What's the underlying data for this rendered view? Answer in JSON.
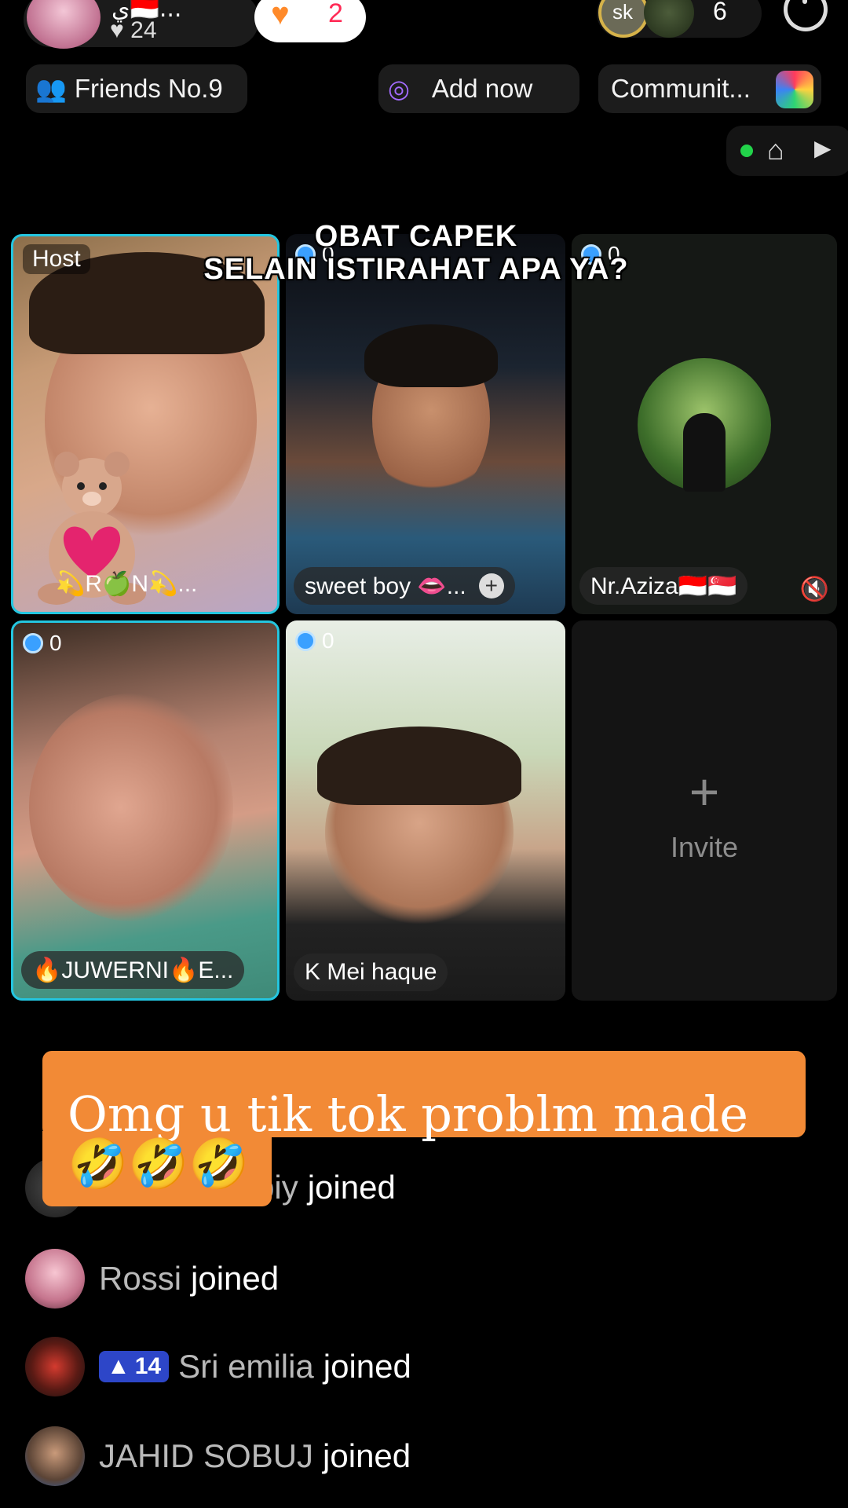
{
  "host": {
    "name": "ي🇮🇩...",
    "likes": "24"
  },
  "gift": {
    "count": "2"
  },
  "viewers": {
    "av1_text": "sk",
    "count": "6"
  },
  "chips": {
    "friends": "Friends No.9",
    "add_now": "Add now",
    "community": "Communit..."
  },
  "topic": {
    "line1": "OBAT CAPEK",
    "line2": "SELAIN ISTIRAHAT APA YA?"
  },
  "tiles": {
    "t1": {
      "label": "Host",
      "name": "💫R🍏N💫..."
    },
    "t2": {
      "coin": "0",
      "name": "sweet boy 👄...",
      "plus": "+"
    },
    "t3": {
      "coin": "0",
      "name": "Nr.Aziza🇮🇩🇸🇬"
    },
    "t4": {
      "coin": "0",
      "name": "🔥JUWERNI🔥E..."
    },
    "t5": {
      "coin": "0",
      "name": "K Mei haque"
    },
    "t6": {
      "plus": "+",
      "label": "Invite"
    }
  },
  "comment": {
    "text": "Omg u tik tok problm made",
    "emoji": "🤣🤣🤣"
  },
  "feed": [
    {
      "name": "biy",
      "action": "joined",
      "level": ""
    },
    {
      "name": "Rossi",
      "action": "joined",
      "level": ""
    },
    {
      "name": "Sri emilia",
      "action": "joined",
      "level": "14"
    },
    {
      "name": "JAHID SOBUJ",
      "action": "joined",
      "level": ""
    }
  ]
}
